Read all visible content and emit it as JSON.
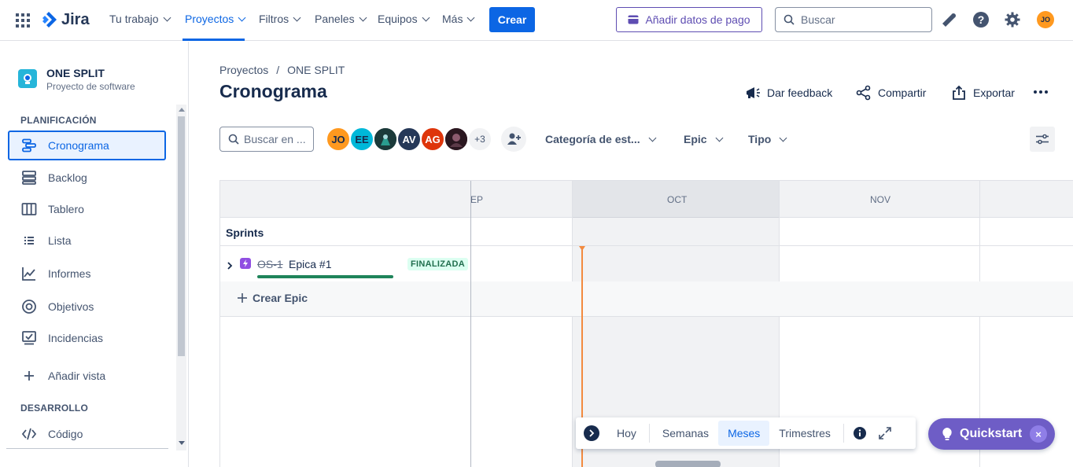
{
  "topnav": {
    "logo_text": "Jira",
    "items": [
      {
        "label": "Tu trabajo"
      },
      {
        "label": "Proyectos"
      },
      {
        "label": "Filtros"
      },
      {
        "label": "Paneles"
      },
      {
        "label": "Equipos"
      },
      {
        "label": "Más"
      }
    ],
    "create_label": "Crear",
    "payment_label": "Añadir datos de pago",
    "search_placeholder": "Buscar",
    "avatar_initials": "JO"
  },
  "sidebar": {
    "project_name": "ONE SPLIT",
    "project_type": "Proyecto de software",
    "planning_title": "PLANIFICACIÓN",
    "items": [
      {
        "label": "Cronograma"
      },
      {
        "label": "Backlog"
      },
      {
        "label": "Tablero"
      },
      {
        "label": "Lista"
      },
      {
        "label": "Informes"
      },
      {
        "label": "Objetivos"
      },
      {
        "label": "Incidencias"
      }
    ],
    "add_view_label": "Añadir vista",
    "dev_title": "DESARROLLO",
    "code_label": "Código"
  },
  "main": {
    "breadcrumb": [
      "Proyectos",
      "/",
      "ONE SPLIT"
    ],
    "title": "Cronograma",
    "actions": {
      "feedback": "Dar feedback",
      "share": "Compartir",
      "export": "Exportar"
    },
    "search_placeholder": "Buscar en ...",
    "avatars": [
      {
        "initials": "JO",
        "color": "#ff991f"
      },
      {
        "initials": "EE",
        "color": "#00b8d9"
      },
      {
        "initials": "",
        "color": "#1b3a3a"
      },
      {
        "initials": "AV",
        "color": "#253858"
      },
      {
        "initials": "AG",
        "color": "#de350b"
      },
      {
        "initials": "",
        "color": "#3d1f2b"
      }
    ],
    "avatars_more": "+3",
    "filters": {
      "category": "Categoría de est...",
      "epic": "Epic",
      "type": "Tipo"
    }
  },
  "timeline": {
    "months": [
      "EP",
      "OCT",
      "NOV"
    ],
    "sprints_label": "Sprints",
    "epic": {
      "key": "OS-1",
      "name": "Epica #1",
      "status": "FINALIZADA",
      "progress": 1.0
    },
    "create_epic_label": "Crear Epic"
  },
  "viewbar": {
    "today": "Hoy",
    "weeks": "Semanas",
    "months": "Meses",
    "quarters": "Trimestres",
    "active": "Meses"
  },
  "quickstart": {
    "label": "Quickstart",
    "close": "×"
  },
  "colors": {
    "accent": "#0c66e4",
    "quickstart": "#6e5dc6",
    "today_line": "#f38a3f",
    "done_green": "#1f845a"
  }
}
